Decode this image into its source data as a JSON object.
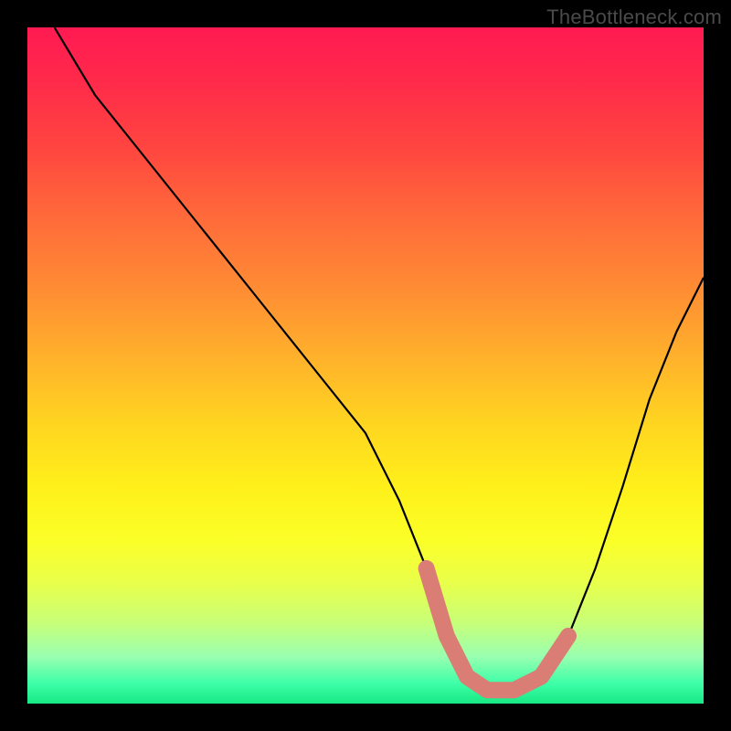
{
  "watermark": "TheBottleneck.com",
  "chart_data": {
    "type": "line",
    "title": "",
    "xlabel": "",
    "ylabel": "",
    "xlim": [
      0,
      100
    ],
    "ylim": [
      0,
      100
    ],
    "series": [
      {
        "name": "bottleneck-curve",
        "x": [
          4,
          10,
          18,
          26,
          34,
          42,
          50,
          55,
          59,
          62,
          65,
          68,
          72,
          76,
          80,
          84,
          88,
          92,
          96,
          100
        ],
        "y": [
          100,
          90,
          80,
          70,
          60,
          50,
          40,
          30,
          20,
          10,
          4,
          2,
          2,
          4,
          10,
          20,
          32,
          45,
          55,
          63
        ]
      }
    ],
    "highlight": {
      "name": "optimal-zone",
      "color": "#d97d75",
      "x": [
        59,
        62,
        65,
        68,
        72,
        76,
        80
      ],
      "y": [
        20,
        10,
        4,
        2,
        2,
        4,
        10
      ]
    }
  }
}
